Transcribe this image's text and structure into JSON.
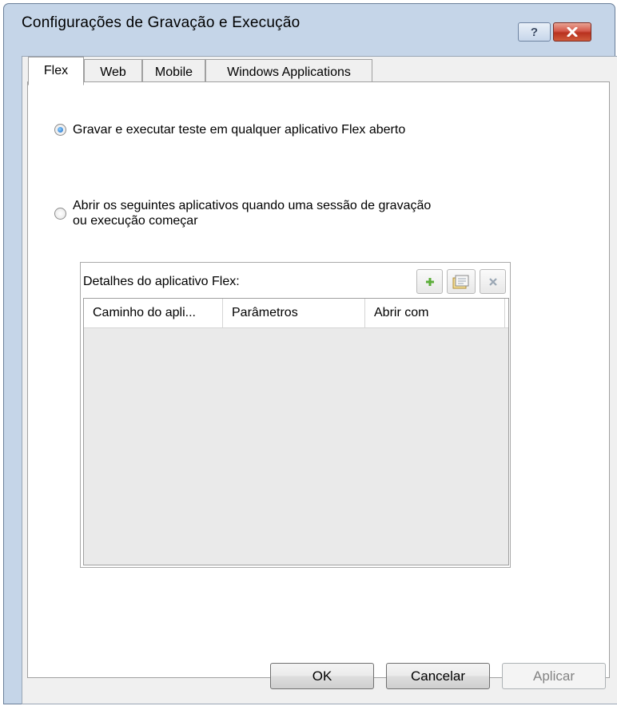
{
  "window": {
    "title": "Configurações de Gravação e Execução",
    "help_label": "?",
    "close_label": "✕"
  },
  "tabs": [
    {
      "label": "Flex",
      "active": true
    },
    {
      "label": "Web",
      "active": false
    },
    {
      "label": "Mobile",
      "active": false
    },
    {
      "label": "Windows Applications",
      "active": false
    }
  ],
  "flex_panel": {
    "option_any": {
      "label": "Gravar e executar teste em qualquer aplicativo Flex aberto",
      "checked": true
    },
    "option_open": {
      "label_line1": "Abrir os seguintes aplicativos quando uma sessão de gravação",
      "label_line2": "ou execução começar",
      "checked": false
    },
    "details_group": {
      "label": "Detalhes do aplicativo Flex:",
      "toolbar": [
        "add-icon",
        "edit-icon",
        "delete-icon"
      ],
      "columns": [
        "Caminho do apli...",
        "Parâmetros",
        "Abrir com"
      ],
      "rows": []
    }
  },
  "buttons": {
    "ok": "OK",
    "cancel": "Cancelar",
    "apply": "Aplicar"
  },
  "colors": {
    "frame": "#c5d5e8",
    "close_button": "#c9432f",
    "radio_checked": "#1967c2",
    "add_icon": "#5cae3a"
  }
}
